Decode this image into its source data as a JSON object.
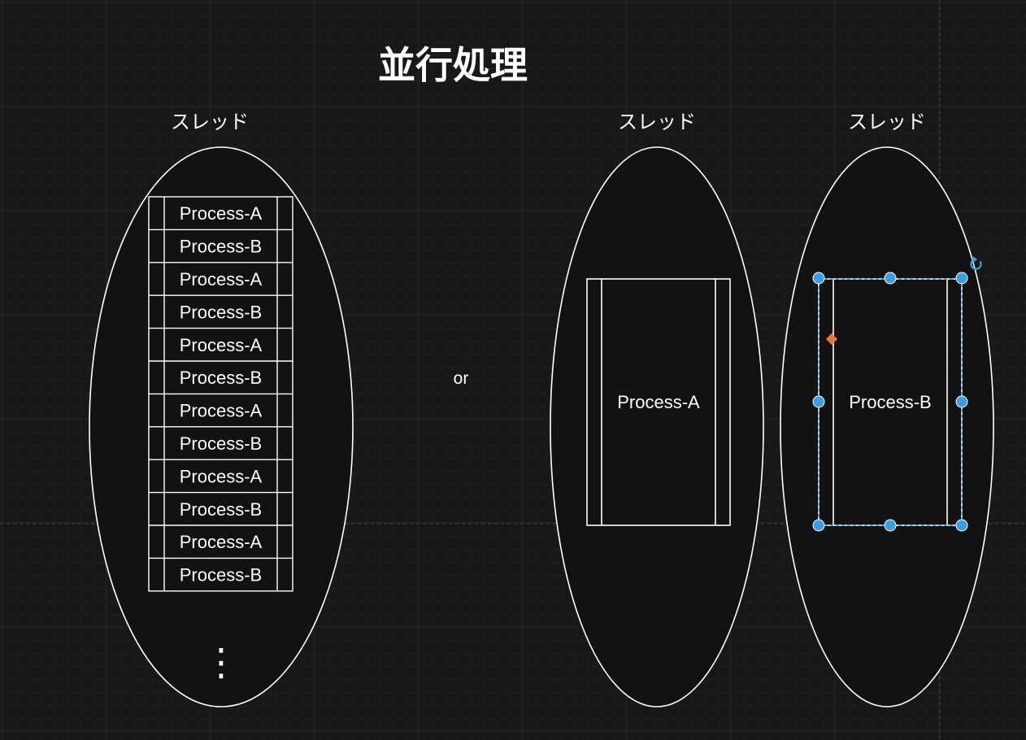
{
  "title": "並行処理",
  "separator": "or",
  "colors": {
    "background": "#181818",
    "grid_minor": "#222222",
    "grid_major": "#2c2c2c",
    "shape_fill": "#121212",
    "stroke": "#ffffff",
    "selection": "#3a9ee4",
    "anchor": "#e8743b"
  },
  "threads": [
    {
      "label": "スレッド",
      "processes": [
        "Process-A",
        "Process-B",
        "Process-A",
        "Process-B",
        "Process-A",
        "Process-B",
        "Process-A",
        "Process-B",
        "Process-A",
        "Process-B",
        "Process-A",
        "Process-B"
      ],
      "continuation": "⋮"
    },
    {
      "label": "スレッド",
      "process": "Process-A"
    },
    {
      "label": "スレッド",
      "process": "Process-B",
      "selected": true,
      "rotate_handle_icon": "rotate-icon"
    }
  ]
}
